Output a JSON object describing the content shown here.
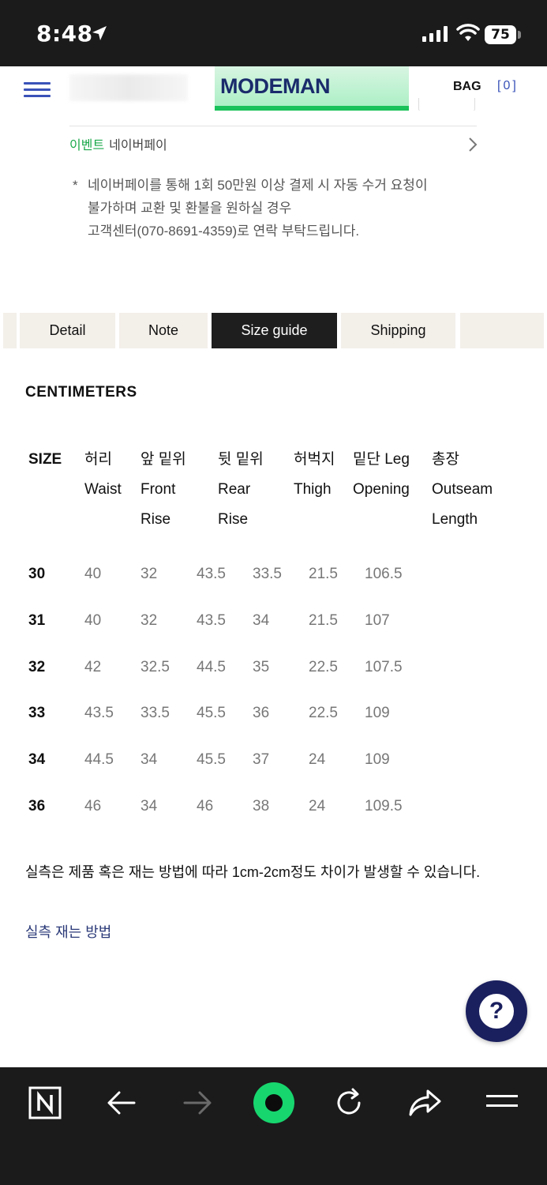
{
  "status_bar": {
    "time": "8:48",
    "battery": "75"
  },
  "header": {
    "logo": "MODEMAN",
    "bag_label": "BAG",
    "bag_count": "[0]"
  },
  "event": {
    "label": "이벤트",
    "text": "네이버페이"
  },
  "notice": {
    "star": "*",
    "lines": [
      "네이버페이를 통해 1회 50만원 이상 결제 시 자동 수거 요청이",
      "불가하며 교환 및 환불을 원하실 경우",
      "고객센터(070-8691-4359)로 연락 부탁드립니다."
    ]
  },
  "tabs": [
    "Detail",
    "Note",
    "Size guide",
    "Shipping"
  ],
  "active_tab": "Size guide",
  "size_guide": {
    "units": "CENTIMETERS",
    "headers": [
      {
        "lines": [
          "SIZE"
        ]
      },
      {
        "lines": [
          "허리",
          "Waist"
        ]
      },
      {
        "lines": [
          "앞 밑위",
          "Front",
          "Rise"
        ]
      },
      {
        "lines": [
          "뒷 밑위",
          "Rear",
          "Rise"
        ]
      },
      {
        "lines": [
          "허벅지",
          "Thigh"
        ]
      },
      {
        "lines": [
          "밑단 Leg",
          "Opening"
        ]
      },
      {
        "lines": [
          "총장",
          "Outseam",
          "Length"
        ]
      }
    ],
    "rows": [
      [
        "30",
        "40",
        "32",
        "43.5",
        "33.5",
        "21.5",
        "106.5"
      ],
      [
        "31",
        "40",
        "32",
        "43.5",
        "34",
        "21.5",
        "107"
      ],
      [
        "32",
        "42",
        "32.5",
        "44.5",
        "35",
        "22.5",
        "107.5"
      ],
      [
        "33",
        "43.5",
        "33.5",
        "45.5",
        "36",
        "22.5",
        "109"
      ],
      [
        "34",
        "44.5",
        "34",
        "45.5",
        "37",
        "24",
        "109"
      ],
      [
        "36",
        "46",
        "34",
        "46",
        "38",
        "24",
        "109.5"
      ]
    ],
    "note": "실측은 제품 혹은 재는 방법에 따라 1cm-2cm정도 차이가 발생할 수 있습니다.",
    "link": "실측 재는 방법"
  },
  "help_button": "?",
  "bottom_nav": [
    "n-logo-icon",
    "back-arrow-icon",
    "forward-arrow-icon",
    "home-circle-icon",
    "reload-icon",
    "share-icon",
    "menu-icon"
  ]
}
